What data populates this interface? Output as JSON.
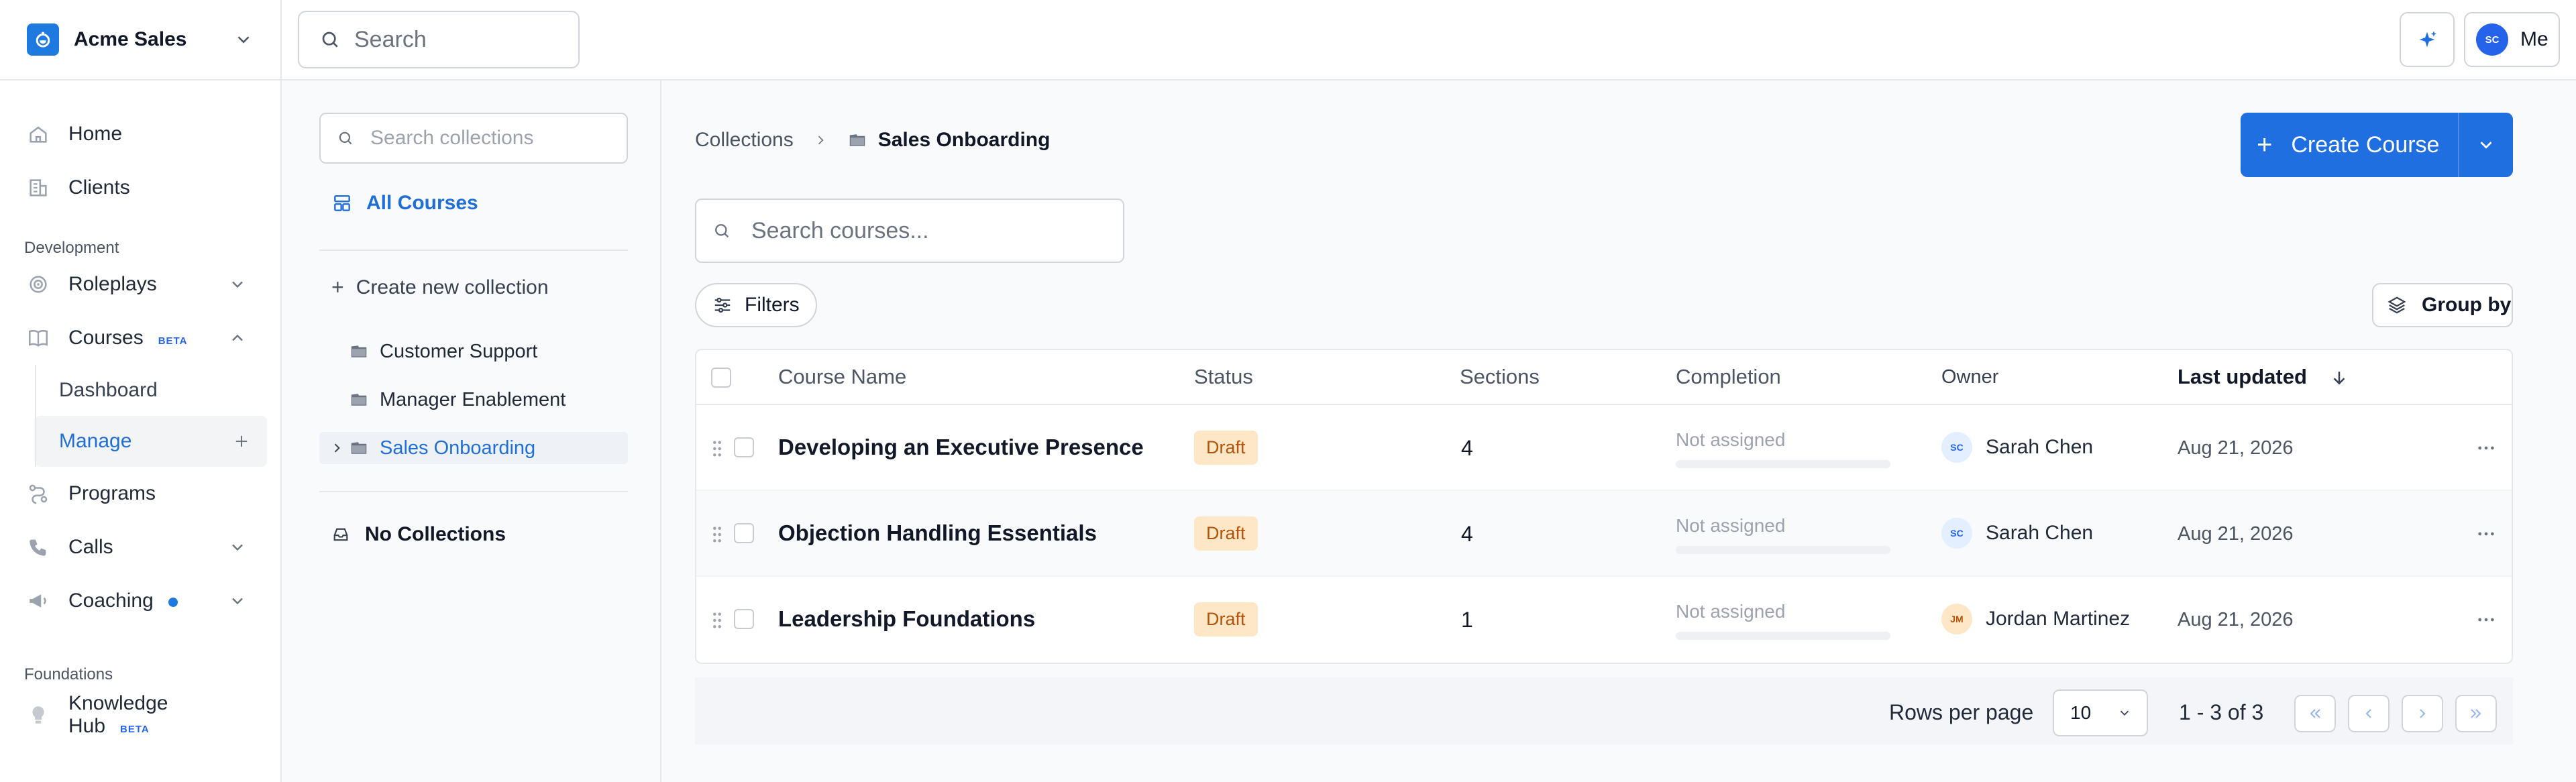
{
  "colors": {
    "accent": "#1f6fe0",
    "link": "#1f6fd6",
    "draft_bg": "#fde7c6",
    "draft_text": "#b45309"
  },
  "org": {
    "name": "Acme Sales",
    "icon": "brand-logo-icon"
  },
  "sidebar": {
    "items_top": [
      {
        "label": "Home",
        "icon": "home-icon"
      },
      {
        "label": "Clients",
        "icon": "clients-icon"
      }
    ],
    "section_development": "Development",
    "roleplays": {
      "label": "Roleplays",
      "icon": "target-icon"
    },
    "courses": {
      "label": "Courses",
      "badge": "BETA",
      "icon": "book-icon"
    },
    "courses_sub": [
      {
        "label": "Dashboard"
      },
      {
        "label": "Manage"
      }
    ],
    "programs": {
      "label": "Programs",
      "icon": "programs-icon"
    },
    "calls": {
      "label": "Calls",
      "icon": "phone-icon"
    },
    "coaching": {
      "label": "Coaching",
      "icon": "megaphone-icon"
    },
    "section_foundations": "Foundations",
    "knowledge": {
      "label": "Knowledge Hub",
      "badge": "BETA",
      "icon": "lightbulb-icon"
    }
  },
  "topbar": {
    "search_placeholder": "Search",
    "user_initials": "SC",
    "user_label": "Me"
  },
  "collections": {
    "search_placeholder": "Search collections",
    "all_courses": "All Courses",
    "create_new": "Create new collection",
    "items": [
      {
        "label": "Customer Support"
      },
      {
        "label": "Manager Enablement"
      },
      {
        "label": "Sales Onboarding"
      }
    ],
    "no_collections": "No Collections"
  },
  "main": {
    "breadcrumb_root": "Collections",
    "breadcrumb_current": "Sales Onboarding",
    "create_course": "Create Course",
    "search_placeholder": "Search courses...",
    "filters": "Filters",
    "group_by": "Group by"
  },
  "table": {
    "headers": {
      "name": "Course Name",
      "status": "Status",
      "sections": "Sections",
      "completion": "Completion",
      "owner": "Owner",
      "updated": "Last updated"
    },
    "rows": [
      {
        "name": "Developing an Executive Presence",
        "status": "Draft",
        "sections": "4",
        "completion": "Not assigned",
        "owner_initials": "SC",
        "owner": "Sarah Chen",
        "updated": "Aug 21, 2026"
      },
      {
        "name": "Objection Handling Essentials",
        "status": "Draft",
        "sections": "4",
        "completion": "Not assigned",
        "owner_initials": "SC",
        "owner": "Sarah Chen",
        "updated": "Aug 21, 2026"
      },
      {
        "name": "Leadership Foundations",
        "status": "Draft",
        "sections": "1",
        "completion": "Not assigned",
        "owner_initials": "JM",
        "owner": "Jordan Martinez",
        "updated": "Aug 21, 2026"
      }
    ]
  },
  "pagination": {
    "rows_label": "Rows per page",
    "rows_value": "10",
    "range": "1 - 3 of 3"
  }
}
